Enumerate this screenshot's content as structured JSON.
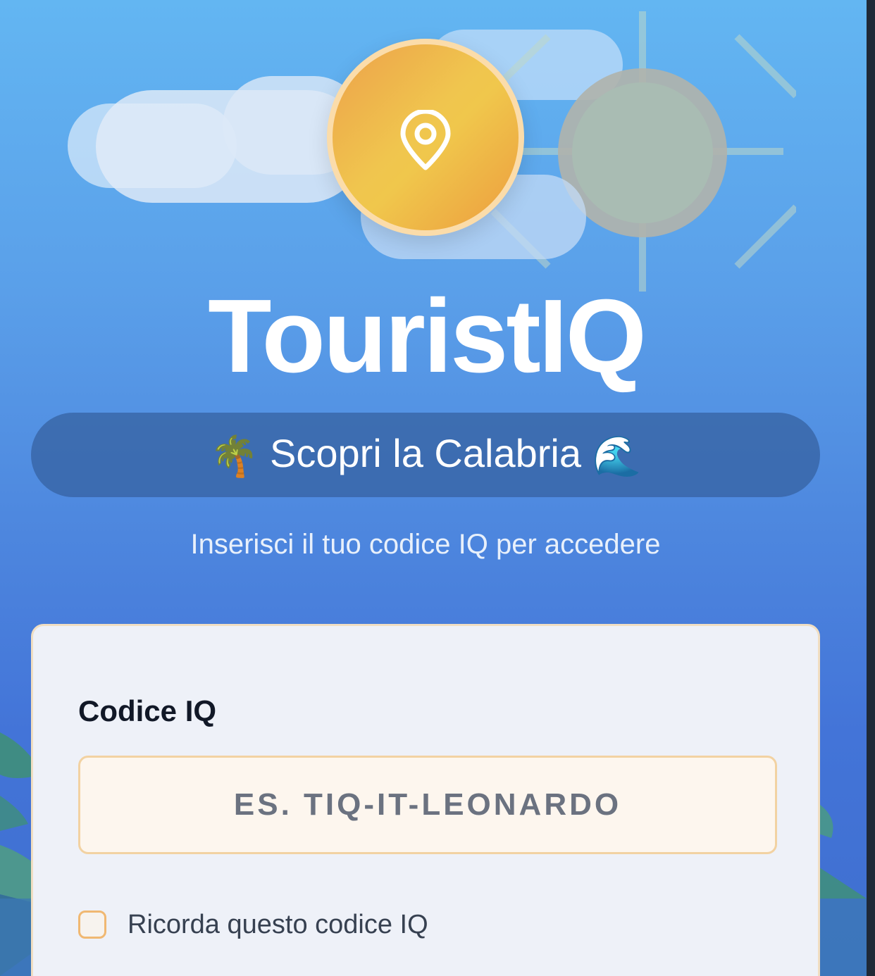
{
  "app": {
    "title": "TouristIQ",
    "tagline": "Scopri la Calabria",
    "tagline_emoji_left": "🌴",
    "tagline_emoji_right": "🌊",
    "subtitle": "Inserisci il tuo codice IQ per accedere"
  },
  "login": {
    "code_label": "Codice IQ",
    "code_value": "",
    "code_placeholder": "ES. TIQ-IT-LEONARDO",
    "remember_label": "Ricorda questo codice IQ",
    "remember_checked": false
  },
  "icons": {
    "logo": "map-pin-icon",
    "sun": "sun-icon"
  },
  "colors": {
    "background_top": "#63b6f2",
    "background_bottom": "#3f6fcf",
    "logo_gradient_start": "#eca14a",
    "logo_gradient_mid": "#f0c54e",
    "tagline_pill": "#34609e",
    "card_background": "#eef1f8",
    "input_border": "#f2d2a2",
    "checkbox_border": "#f0b872"
  }
}
